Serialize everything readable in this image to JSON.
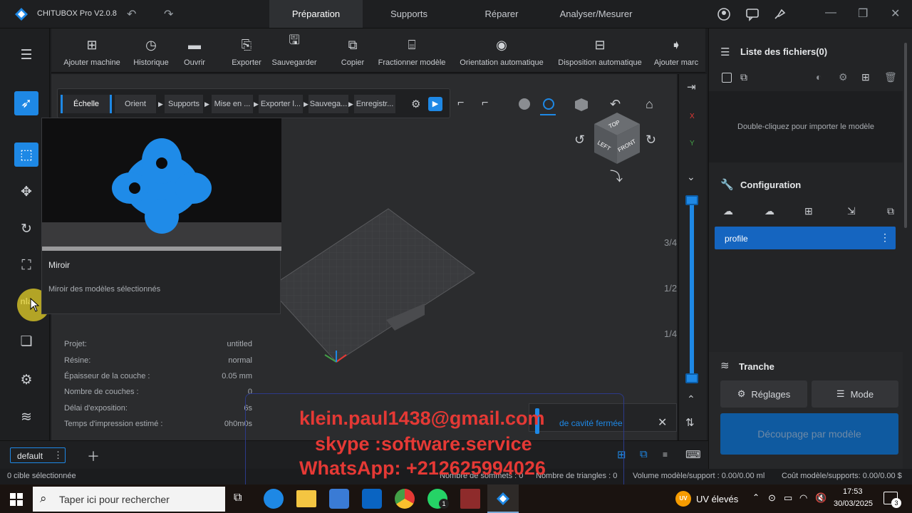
{
  "titlebar": {
    "app_title": "CHITUBOX Pro V2.0.8",
    "tabs": [
      "Préparation",
      "Supports",
      "Réparer",
      "Analyser/Mesurer"
    ],
    "active_tab": "Préparation"
  },
  "toolbar": {
    "tools": [
      "Ajouter machine",
      "Historique",
      "Ouvrir",
      "Exporter",
      "Sauvegarder",
      "Copier",
      "Fractionner modèle",
      "Orientation automatique",
      "Disposition automatique",
      "Ajouter marc"
    ]
  },
  "workflow": {
    "steps": [
      "Échelle",
      "Orient",
      "Supports",
      "Mise en ...",
      "Exporter l...",
      "Sauvega...",
      "Enregistr..."
    ]
  },
  "tooltip": {
    "title": "Miroir",
    "description": "Miroir des modèles sélectionnés"
  },
  "sidebar": {
    "partial_label": "nla"
  },
  "info": {
    "rows": [
      {
        "label": "Projet:",
        "value": "untitled"
      },
      {
        "label": "Résine:",
        "value": "normal"
      },
      {
        "label": "Épaisseur de la couche :",
        "value": "0.05 mm"
      },
      {
        "label": "Nombre de couches :",
        "value": "0"
      },
      {
        "label": "Délai d'exposition:",
        "value": "6s"
      },
      {
        "label": "Temps d'impression estimé :",
        "value": "0h0m0s"
      }
    ]
  },
  "view_cube": {
    "top": "TOP",
    "left": "LEFT",
    "front": "FRONT"
  },
  "axes": {
    "x": "X",
    "y": "Y"
  },
  "slider": {
    "fractions": [
      "3/4",
      "1/2",
      "1/4"
    ]
  },
  "notification": {
    "text": "de cavité fermée"
  },
  "right_panel": {
    "file_list_title": "Liste des fichiers(0)",
    "file_list_hint": "Double-cliquez pour importer le modèle",
    "config_title": "Configuration",
    "profile": "profile",
    "slice_title": "Tranche",
    "settings_label": "Réglages",
    "mode_label": "Mode",
    "slice_button": "Découpage par modèle"
  },
  "bottombar": {
    "plate_tab": "default"
  },
  "statusbar": {
    "selection": "0 cible sélectionnée",
    "vertices": "Nombre de sommets : 0",
    "triangles": "Nombre de triangles : 0",
    "volume": "Volume modèle/support : 0.00/0.00 ml",
    "cost": "Coût modèle/supports: 0.00/0.00 $"
  },
  "watermark": {
    "line1": "klein.paul1438@gmail.com",
    "line2": "skype :software.service",
    "line3": "WhatsApp: +212625994026"
  },
  "taskbar": {
    "search_placeholder": "Taper ici pour rechercher",
    "weather": "UV élevés",
    "weather_badge": "UV",
    "time": "17:53",
    "date": "30/03/2025",
    "notif_count": "3",
    "whatsapp_badge": "1"
  },
  "colors": {
    "accent": "#1e88e5",
    "watermark": "#e53935",
    "model": "#1f8be8"
  }
}
